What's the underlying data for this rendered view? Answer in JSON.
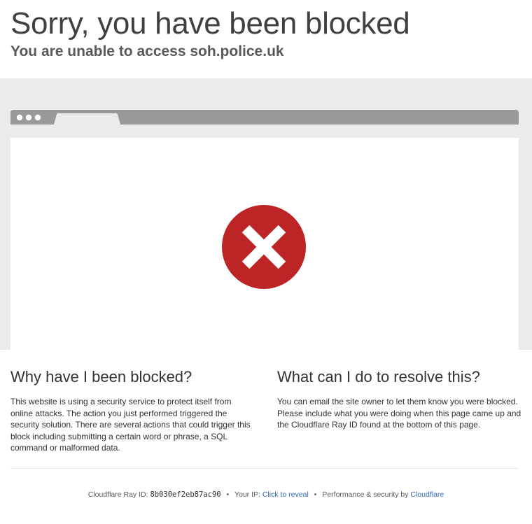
{
  "header": {
    "title": "Sorry, you have been blocked",
    "subtitle": "You are unable to access soh.police.uk"
  },
  "colors": {
    "error_red": "#bd2426",
    "link_blue": "#2f68b8",
    "band_gray": "#ebebeb",
    "bar_gray": "#999999"
  },
  "illustration": {
    "icon": "x-circle-icon"
  },
  "why": {
    "heading": "Why have I been blocked?",
    "body": "This website is using a security service to protect itself from online attacks. The action you just performed triggered the security solution. There are several actions that could trigger this block including submitting a certain word or phrase, a SQL command or malformed data."
  },
  "resolve": {
    "heading": "What can I do to resolve this?",
    "body": "You can email the site owner to let them know you were blocked. Please include what you were doing when this page came up and the Cloudflare Ray ID found at the bottom of this page."
  },
  "footer": {
    "ray_label": "Cloudflare Ray ID:",
    "ray_id": "8b030ef2eb87ac90",
    "separator": "•",
    "ip_label": "Your IP:",
    "ip_link": "Click to reveal",
    "perf_label": "Performance & security by",
    "cf_link": "Cloudflare"
  }
}
